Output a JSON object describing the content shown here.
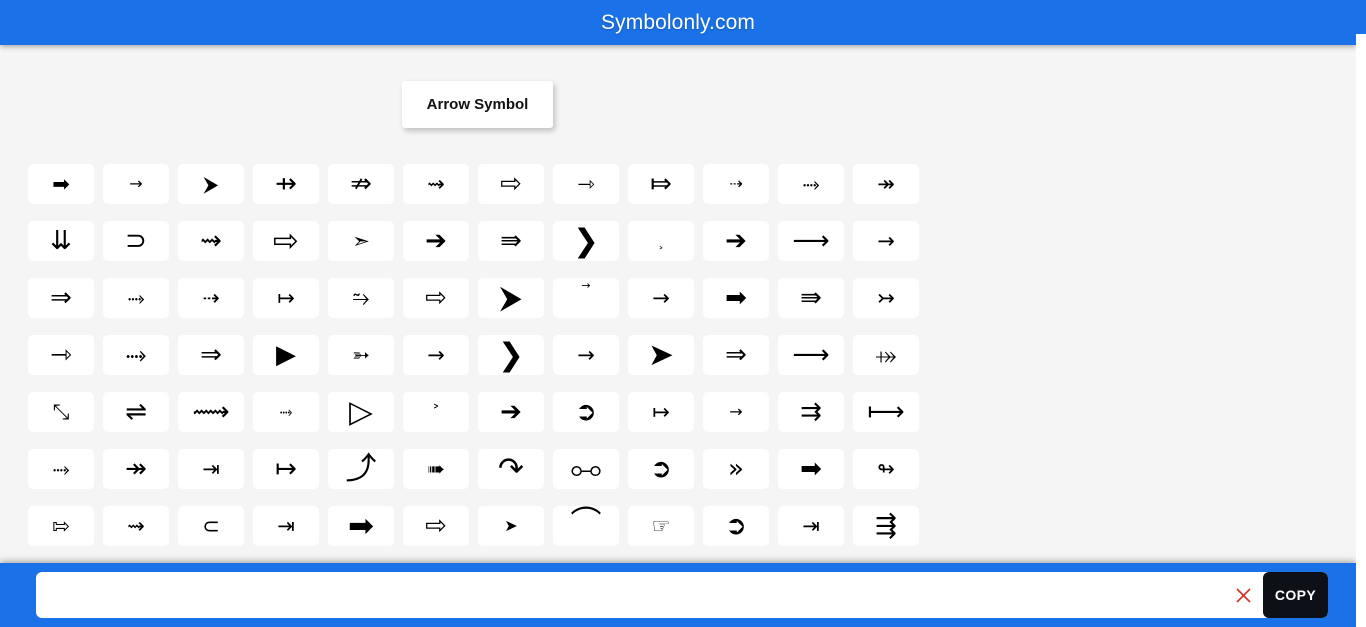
{
  "header": {
    "title": "Symbolonly.com",
    "brand_color": "#1b72e8"
  },
  "category": {
    "label": "Arrow Symbol"
  },
  "symbols": {
    "rows": [
      [
        {
          "glyph": "➡",
          "size": "sz-m",
          "align": "center"
        },
        {
          "glyph": "→",
          "size": "sz-s",
          "align": "center"
        },
        {
          "glyph": "⮞",
          "size": "sz-m",
          "align": "center"
        },
        {
          "glyph": "⇸",
          "size": "sz-l",
          "align": "center"
        },
        {
          "glyph": "⇏",
          "size": "sz-l",
          "align": "center"
        },
        {
          "glyph": "⇝",
          "size": "sz-m",
          "align": "center"
        },
        {
          "glyph": "⇨",
          "size": "sz-l",
          "align": "center"
        },
        {
          "glyph": "⇾",
          "size": "sz-m",
          "align": "center"
        },
        {
          "glyph": "⤇",
          "size": "sz-l",
          "align": "center"
        },
        {
          "glyph": "⇢",
          "size": "sz-s",
          "align": "center"
        },
        {
          "glyph": "⤑",
          "size": "sz-m",
          "align": "center"
        },
        {
          "glyph": "↠",
          "size": "sz-m",
          "align": "center"
        }
      ],
      [
        {
          "glyph": "⇊",
          "size": "sz-l",
          "align": "center"
        },
        {
          "glyph": "⊃",
          "size": "sz-l",
          "align": "center"
        },
        {
          "glyph": "⇝",
          "size": "sz-l",
          "align": "center"
        },
        {
          "glyph": "⇨",
          "size": "sz-xl",
          "align": "center"
        },
        {
          "glyph": "➣",
          "size": "sz-m",
          "align": "center"
        },
        {
          "glyph": "➔",
          "size": "sz-l",
          "align": "center"
        },
        {
          "glyph": "⇛",
          "size": "sz-l",
          "align": "center"
        },
        {
          "glyph": "❯",
          "size": "sz-xl",
          "align": "center"
        },
        {
          "glyph": "˃",
          "size": "sz-xs",
          "align": "bottom"
        },
        {
          "glyph": "➔",
          "size": "sz-l",
          "align": "center"
        },
        {
          "glyph": "⟶",
          "size": "sz-l",
          "align": "center"
        },
        {
          "glyph": "→",
          "size": "sz-m",
          "align": "center"
        }
      ],
      [
        {
          "glyph": "⇒",
          "size": "sz-l",
          "align": "center"
        },
        {
          "glyph": "⤑",
          "size": "sz-m",
          "align": "center"
        },
        {
          "glyph": "⇢",
          "size": "sz-m",
          "align": "center"
        },
        {
          "glyph": "↦",
          "size": "sz-m",
          "align": "center"
        },
        {
          "glyph": "⥲",
          "size": "sz-m",
          "align": "center"
        },
        {
          "glyph": "⇨",
          "size": "sz-l",
          "align": "center"
        },
        {
          "glyph": "⮞",
          "size": "sz-xl",
          "align": "center"
        },
        {
          "glyph": "→",
          "size": "sz-xs",
          "align": "top"
        },
        {
          "glyph": "→",
          "size": "sz-m",
          "align": "center"
        },
        {
          "glyph": "➡",
          "size": "sz-l",
          "align": "center"
        },
        {
          "glyph": "⇛",
          "size": "sz-l",
          "align": "center"
        },
        {
          "glyph": "↣",
          "size": "sz-m",
          "align": "center"
        }
      ],
      [
        {
          "glyph": "⇾",
          "size": "sz-l",
          "align": "center"
        },
        {
          "glyph": "⤑",
          "size": "sz-l",
          "align": "center"
        },
        {
          "glyph": "⇒",
          "size": "sz-l",
          "align": "center"
        },
        {
          "glyph": "▶",
          "size": "sz-l",
          "align": "center"
        },
        {
          "glyph": "➳",
          "size": "sz-m",
          "align": "center"
        },
        {
          "glyph": "→",
          "size": "sz-m",
          "align": "center"
        },
        {
          "glyph": "❯",
          "size": "sz-xl",
          "align": "center"
        },
        {
          "glyph": "→",
          "size": "sz-m",
          "align": "center"
        },
        {
          "glyph": "➤",
          "size": "sz-xl",
          "align": "center"
        },
        {
          "glyph": "⇒",
          "size": "sz-l",
          "align": "center"
        },
        {
          "glyph": "⟶",
          "size": "sz-l",
          "align": "center"
        },
        {
          "glyph": "⤀",
          "size": "sz-m",
          "align": "center"
        }
      ],
      [
        {
          "glyph": "⤡",
          "size": "sz-m",
          "align": "center"
        },
        {
          "glyph": "⇌",
          "size": "sz-l",
          "align": "center"
        },
        {
          "glyph": "⟿",
          "size": "sz-l",
          "align": "center"
        },
        {
          "glyph": "⤑",
          "size": "sz-s",
          "align": "center"
        },
        {
          "glyph": "▷",
          "size": "sz-xl",
          "align": "center"
        },
        {
          "glyph": "˃",
          "size": "sz-s",
          "align": "center"
        },
        {
          "glyph": "➔",
          "size": "sz-l",
          "align": "center"
        },
        {
          "glyph": "➲",
          "size": "sz-l",
          "align": "center"
        },
        {
          "glyph": "↦",
          "size": "sz-m",
          "align": "center"
        },
        {
          "glyph": "→",
          "size": "sz-s",
          "align": "center"
        },
        {
          "glyph": "⇉",
          "size": "sz-l",
          "align": "center"
        },
        {
          "glyph": "⟼",
          "size": "sz-l",
          "align": "center"
        }
      ],
      [
        {
          "glyph": "⤑",
          "size": "sz-m",
          "align": "center"
        },
        {
          "glyph": "↠",
          "size": "sz-l",
          "align": "center"
        },
        {
          "glyph": "⇥",
          "size": "sz-m",
          "align": "center"
        },
        {
          "glyph": "↦",
          "size": "sz-l",
          "align": "center"
        },
        {
          "glyph": "⤴",
          "size": "sz-xl",
          "align": "center"
        },
        {
          "glyph": "➠",
          "size": "sz-m",
          "align": "center"
        },
        {
          "glyph": "↷",
          "size": "sz-xl",
          "align": "center"
        },
        {
          "glyph": "⧟",
          "size": "sz-xl",
          "align": "center"
        },
        {
          "glyph": "➲",
          "size": "sz-l",
          "align": "center"
        },
        {
          "glyph": "»",
          "size": "sz-l",
          "align": "center"
        },
        {
          "glyph": "➡",
          "size": "sz-l",
          "align": "center"
        },
        {
          "glyph": "↬",
          "size": "sz-m",
          "align": "center"
        }
      ],
      [
        {
          "glyph": "⇰",
          "size": "sz-m",
          "align": "center"
        },
        {
          "glyph": "⇝",
          "size": "sz-m",
          "align": "center"
        },
        {
          "glyph": "⊂",
          "size": "sz-m",
          "align": "center"
        },
        {
          "glyph": "⇥",
          "size": "sz-m",
          "align": "center"
        },
        {
          "glyph": "➡",
          "size": "sz-xl",
          "align": "center"
        },
        {
          "glyph": "⇨",
          "size": "sz-l",
          "align": "center"
        },
        {
          "glyph": "➤",
          "size": "sz-s",
          "align": "center"
        },
        {
          "glyph": "⌒",
          "size": "sz-xl",
          "align": "top"
        },
        {
          "glyph": "☞",
          "size": "sz-m",
          "align": "center"
        },
        {
          "glyph": "➲",
          "size": "sz-l",
          "align": "center"
        },
        {
          "glyph": "⇥",
          "size": "sz-m",
          "align": "center"
        },
        {
          "glyph": "⇶",
          "size": "sz-l",
          "align": "center"
        }
      ]
    ]
  },
  "copy_bar": {
    "input_value": "",
    "input_placeholder": "",
    "clear_label": "✕",
    "copy_label": "COPY",
    "clear_color": "#d5312a",
    "copy_bg": "#0d1117"
  }
}
